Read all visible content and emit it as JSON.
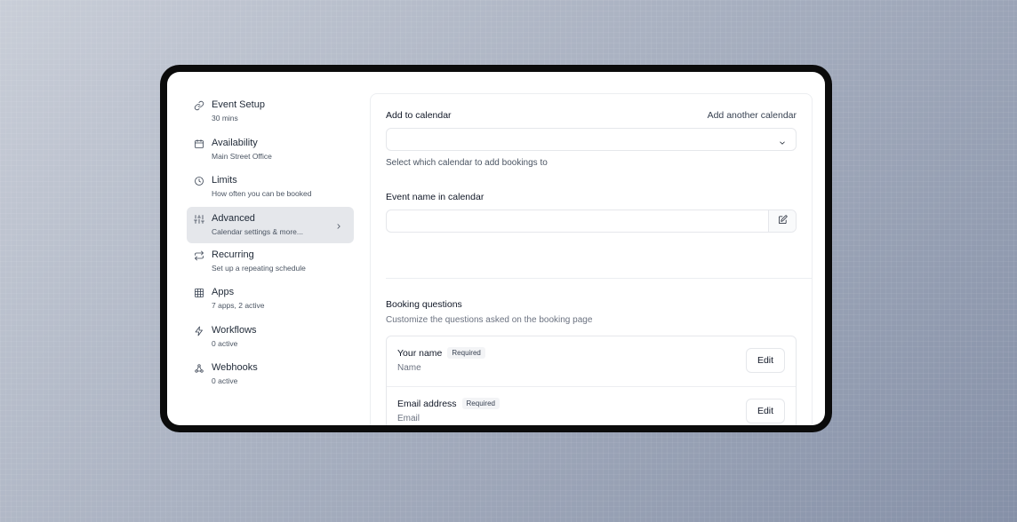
{
  "sidebar": {
    "items": [
      {
        "title": "Event Setup",
        "subtitle": "30 mins",
        "icon": "link-icon"
      },
      {
        "title": "Availability",
        "subtitle": "Main Street Office",
        "icon": "calendar-icon"
      },
      {
        "title": "Limits",
        "subtitle": "How often you can be booked",
        "icon": "clock-icon"
      },
      {
        "title": "Advanced",
        "subtitle": "Calendar settings & more...",
        "icon": "sliders-icon",
        "active": true
      },
      {
        "title": "Recurring",
        "subtitle": "Set up a repeating schedule",
        "icon": "repeat-icon"
      },
      {
        "title": "Apps",
        "subtitle": "7 apps, 2 active",
        "icon": "grid-icon"
      },
      {
        "title": "Workflows",
        "subtitle": "0 active",
        "icon": "zap-icon"
      },
      {
        "title": "Webhooks",
        "subtitle": "0 active",
        "icon": "webhook-icon"
      }
    ]
  },
  "calendar": {
    "label": "Add to calendar",
    "add_link": "Add another calendar",
    "select_value": "",
    "hint": "Select which calendar to add bookings to"
  },
  "event_name": {
    "label": "Event name in calendar",
    "value": ""
  },
  "booking_questions": {
    "title": "Booking questions",
    "subtitle": "Customize the questions asked on the booking page",
    "items": [
      {
        "label": "Your name",
        "badge": "Required",
        "type": "Name",
        "edit": "Edit"
      },
      {
        "label": "Email address",
        "badge": "Required",
        "type": "Email",
        "edit": "Edit"
      }
    ]
  },
  "colors": {
    "active_item_bg": "#e5e7eb",
    "border": "#e5e7eb"
  }
}
